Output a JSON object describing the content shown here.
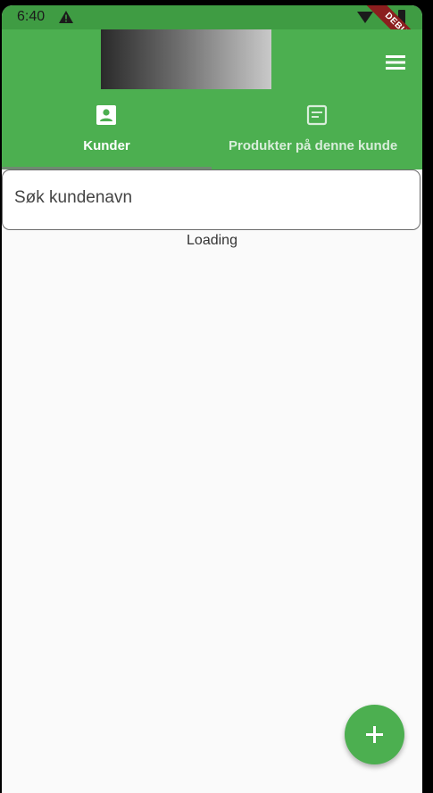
{
  "status_bar": {
    "time": "6:40",
    "debug_label": "DEBUG"
  },
  "app_bar": {
    "logo": "logo-image",
    "menu_icon": "hamburger-menu-icon"
  },
  "tabs": [
    {
      "label": "Kunder",
      "icon": "person-badge-icon",
      "selected": true
    },
    {
      "label": "Produkter på denne kunde",
      "icon": "article-icon",
      "selected": false
    }
  ],
  "search": {
    "placeholder": "Søk kundenavn",
    "value": ""
  },
  "status_text": "Loading",
  "fab": {
    "icon": "plus-icon"
  },
  "colors": {
    "primary": "#4caf50",
    "status_bar": "#3f9c43",
    "background": "#fafafa",
    "debug_ribbon": "#8b1e1e"
  }
}
